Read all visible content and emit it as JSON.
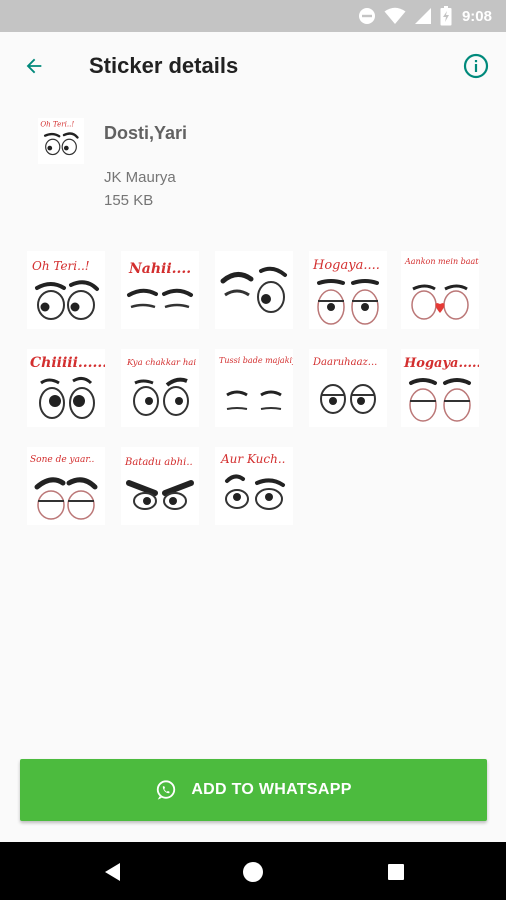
{
  "status_bar": {
    "time": "9:08",
    "icons": [
      "do-not-disturb-icon",
      "wifi-icon",
      "signal-icon",
      "battery-charging-icon"
    ]
  },
  "app_bar": {
    "title": "Sticker details",
    "back_icon": "arrow-back-icon",
    "info_icon": "info-icon"
  },
  "pack": {
    "name": "Dosti,Yari",
    "author": "JK Maurya",
    "size": "155 KB",
    "tray_caption": "Oh Teri..!"
  },
  "stickers": [
    {
      "caption": "Oh Teri..!"
    },
    {
      "caption": "Nahii...."
    },
    {
      "caption": ""
    },
    {
      "caption": "Hogaya...."
    },
    {
      "caption": "Aankon mein baate ho fun..."
    },
    {
      "caption": "Chiiiii......"
    },
    {
      "caption": "Kya chakkar hai !"
    },
    {
      "caption": "Tussi bade majakiya ho"
    },
    {
      "caption": "Daaruhaaz..."
    },
    {
      "caption": "Hogaya....."
    },
    {
      "caption": "Sone de yaar.."
    },
    {
      "caption": "Batadu abhi.."
    },
    {
      "caption": "Aur Kuch.."
    }
  ],
  "add_button": {
    "label": "ADD TO WHATSAPP",
    "icon": "whatsapp-icon"
  },
  "colors": {
    "accent": "#00897b",
    "button": "#4cbb3e",
    "caption": "#d32f2f"
  },
  "nav_bar": {
    "icons": [
      "back-triangle-icon",
      "home-circle-icon",
      "recents-square-icon"
    ]
  }
}
